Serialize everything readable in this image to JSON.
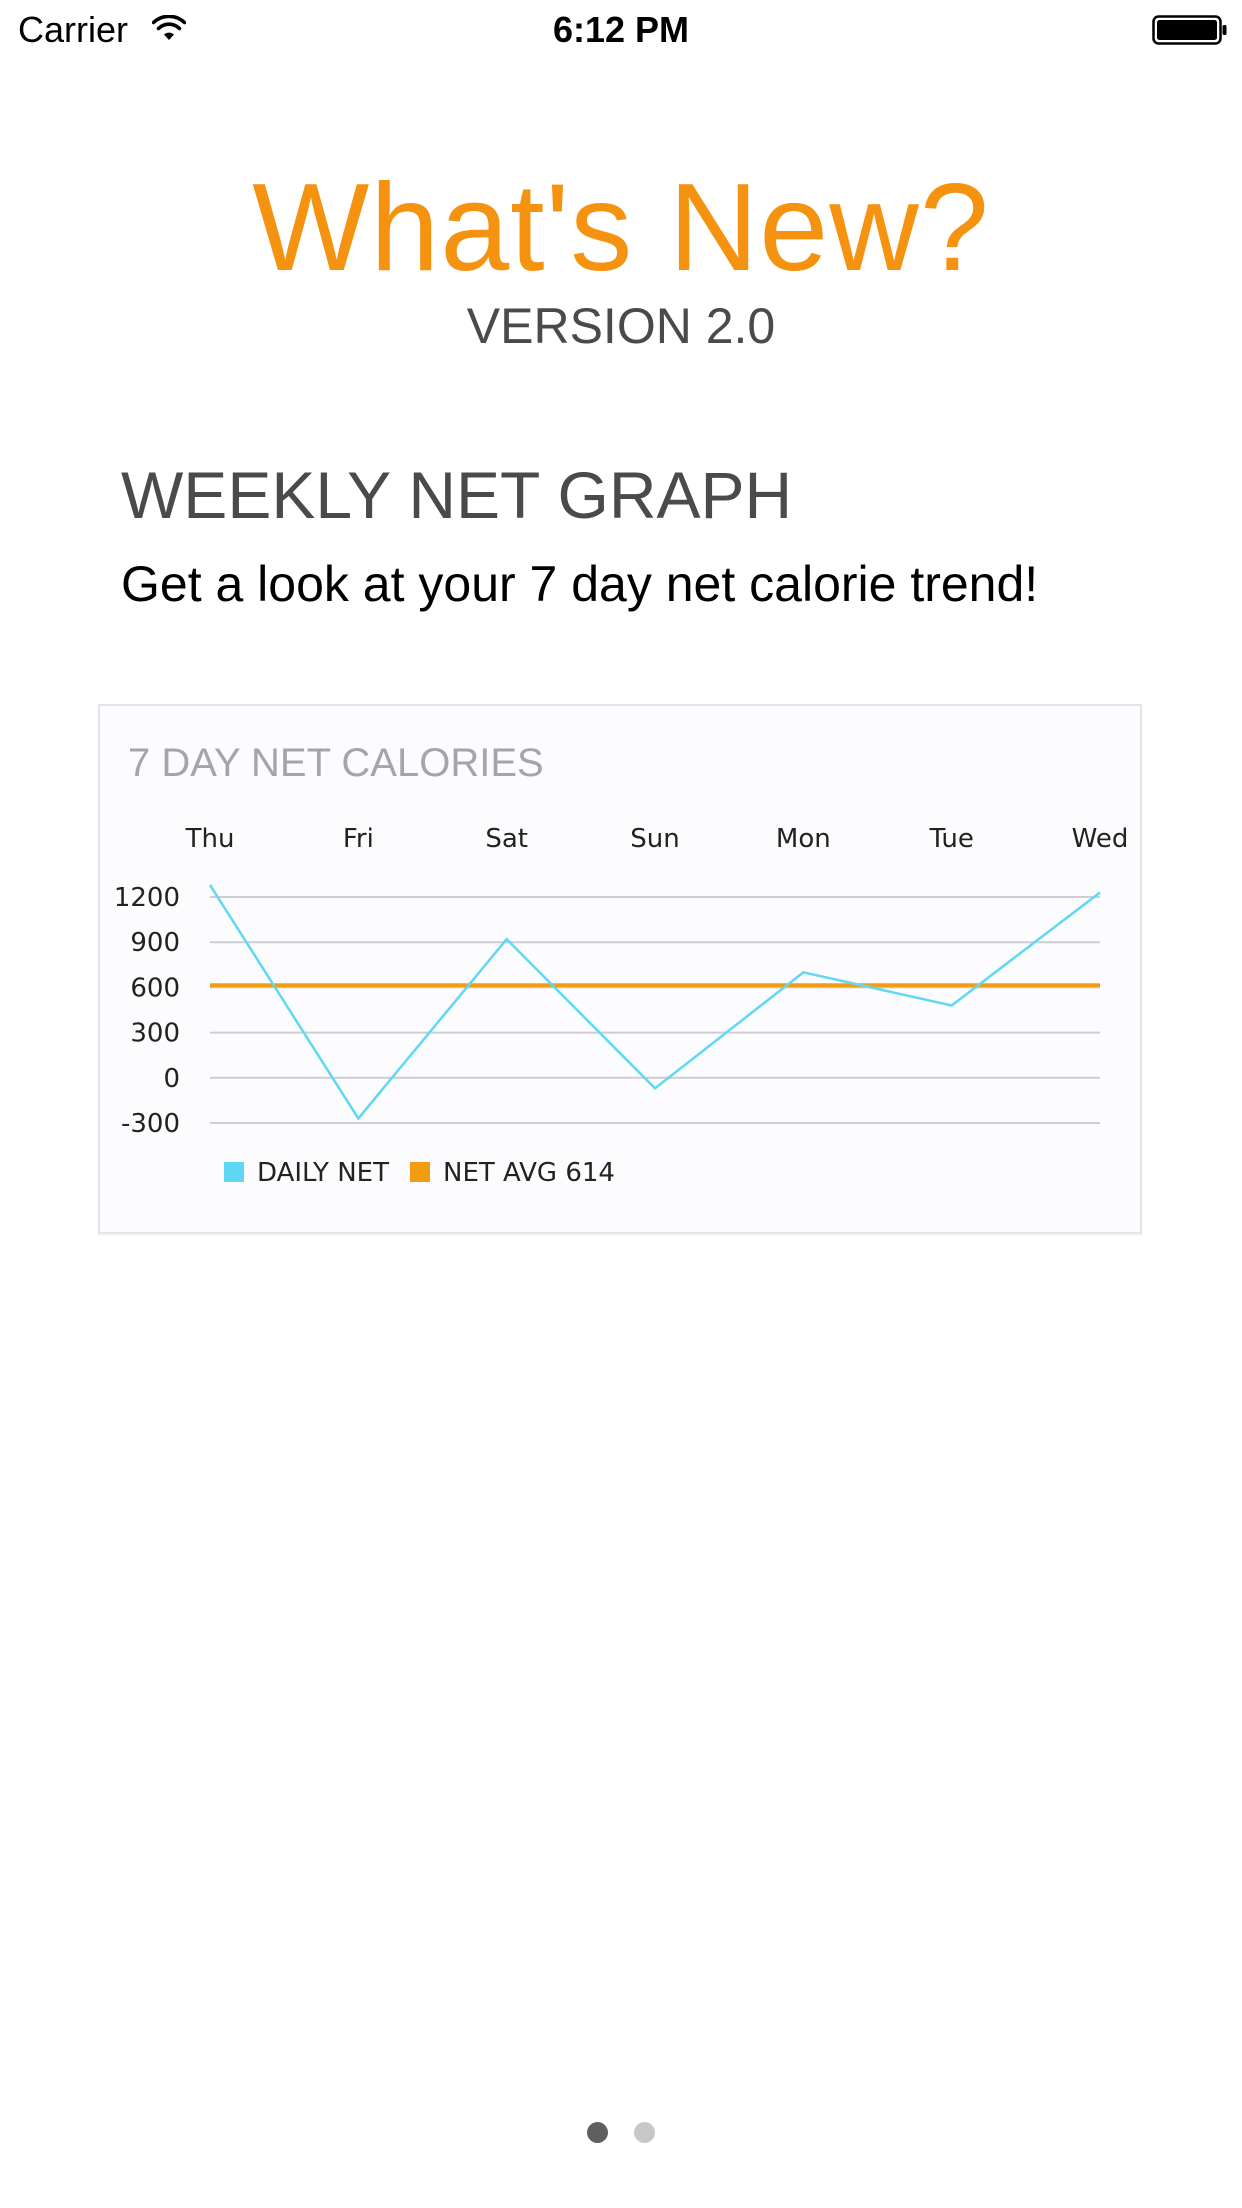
{
  "status_bar": {
    "carrier": "Carrier",
    "time": "6:12 PM",
    "icons": [
      "wifi-icon",
      "battery-icon"
    ]
  },
  "header": {
    "title": "What's New?",
    "version": "VERSION 2.0",
    "title_color": "#f5920f"
  },
  "feature": {
    "title": "WEEKLY NET GRAPH",
    "description": "Get a look at your 7 day net calorie trend!"
  },
  "chart_data": {
    "type": "line",
    "title": "7 DAY NET CALORIES",
    "categories": [
      "Thu",
      "Fri",
      "Sat",
      "Sun",
      "Mon",
      "Tue",
      "Wed"
    ],
    "y_ticks": [
      "1200",
      "900",
      "600",
      "300",
      "0",
      "-300"
    ],
    "ylim": [
      -300,
      1200
    ],
    "series": [
      {
        "name": "DAILY NET",
        "color": "#5fd8f5",
        "values": [
          1280,
          -270,
          920,
          -70,
          700,
          480,
          1230
        ]
      },
      {
        "name": "NET AVG 614",
        "color": "#f39c12",
        "values": [
          614,
          614,
          614,
          614,
          614,
          614,
          614
        ]
      }
    ],
    "legend_placement": "bottom-left",
    "grid": true
  },
  "page_control": {
    "pages": 2,
    "current": 1
  }
}
